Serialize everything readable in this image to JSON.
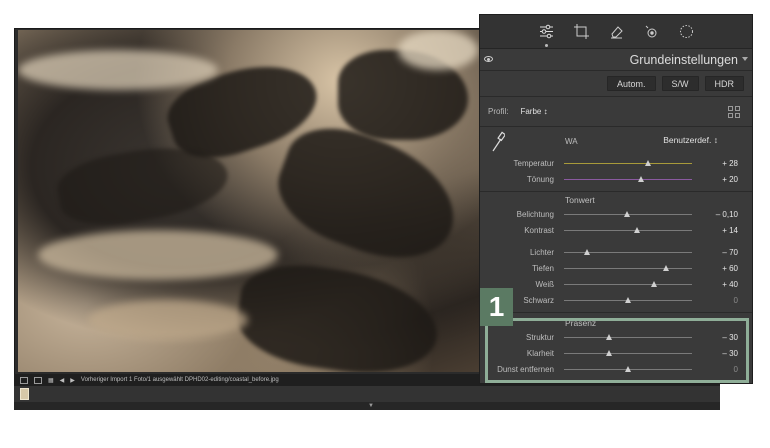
{
  "toolstrip": {
    "tools": [
      {
        "icon": "sliders-icon"
      },
      {
        "icon": "crop-icon"
      },
      {
        "icon": "eraser-icon"
      },
      {
        "icon": "redeye-icon"
      },
      {
        "icon": "masking-icon"
      }
    ]
  },
  "panel": {
    "title": "Grundeinstellungen",
    "modes": [
      "Autom.",
      "S/W",
      "HDR"
    ],
    "profile_label": "Profil:",
    "profile_value": "Farbe ↕",
    "wb_label": "WA",
    "wb_value": "Benutzerdef. ↕",
    "wb_sliders": [
      {
        "label": "Temperatur",
        "value": "+ 28",
        "level": 0.66,
        "track": "#a89a3a"
      },
      {
        "label": "Tönung",
        "value": "+ 20",
        "level": 0.6,
        "track": "#8a5aa0"
      }
    ],
    "tone_head": "Tonwert",
    "tone_sliders": [
      {
        "label": "Belichtung",
        "value": "– 0,10",
        "level": 0.49
      },
      {
        "label": "Kontrast",
        "value": "+ 14",
        "level": 0.57
      }
    ],
    "tone_sliders_2": [
      {
        "label": "Lichter",
        "value": "– 70",
        "level": 0.18
      },
      {
        "label": "Tiefen",
        "value": "+ 60",
        "level": 0.8
      },
      {
        "label": "Weiß",
        "value": "+ 40",
        "level": 0.7
      },
      {
        "label": "Schwarz",
        "value": "0",
        "level": 0.5,
        "dim": true
      }
    ],
    "presence_head": "Präsenz",
    "presence_sliders": [
      {
        "label": "Struktur",
        "value": "– 30",
        "level": 0.35
      },
      {
        "label": "Klarheit",
        "value": "– 30",
        "level": 0.35
      },
      {
        "label": "Dunst entfernen",
        "value": "0",
        "level": 0.5,
        "dim": true
      }
    ]
  },
  "filmstrip": {
    "info": "Vorheriger Import  1 Foto/1 ausgewählt  DPHD02-editing/coastal_before.jpg"
  },
  "callout": "1",
  "colors": {
    "callout_bg": "#5b7a63",
    "highlight_border": "#8fae98",
    "panel_bg": "#3a3a3a"
  }
}
